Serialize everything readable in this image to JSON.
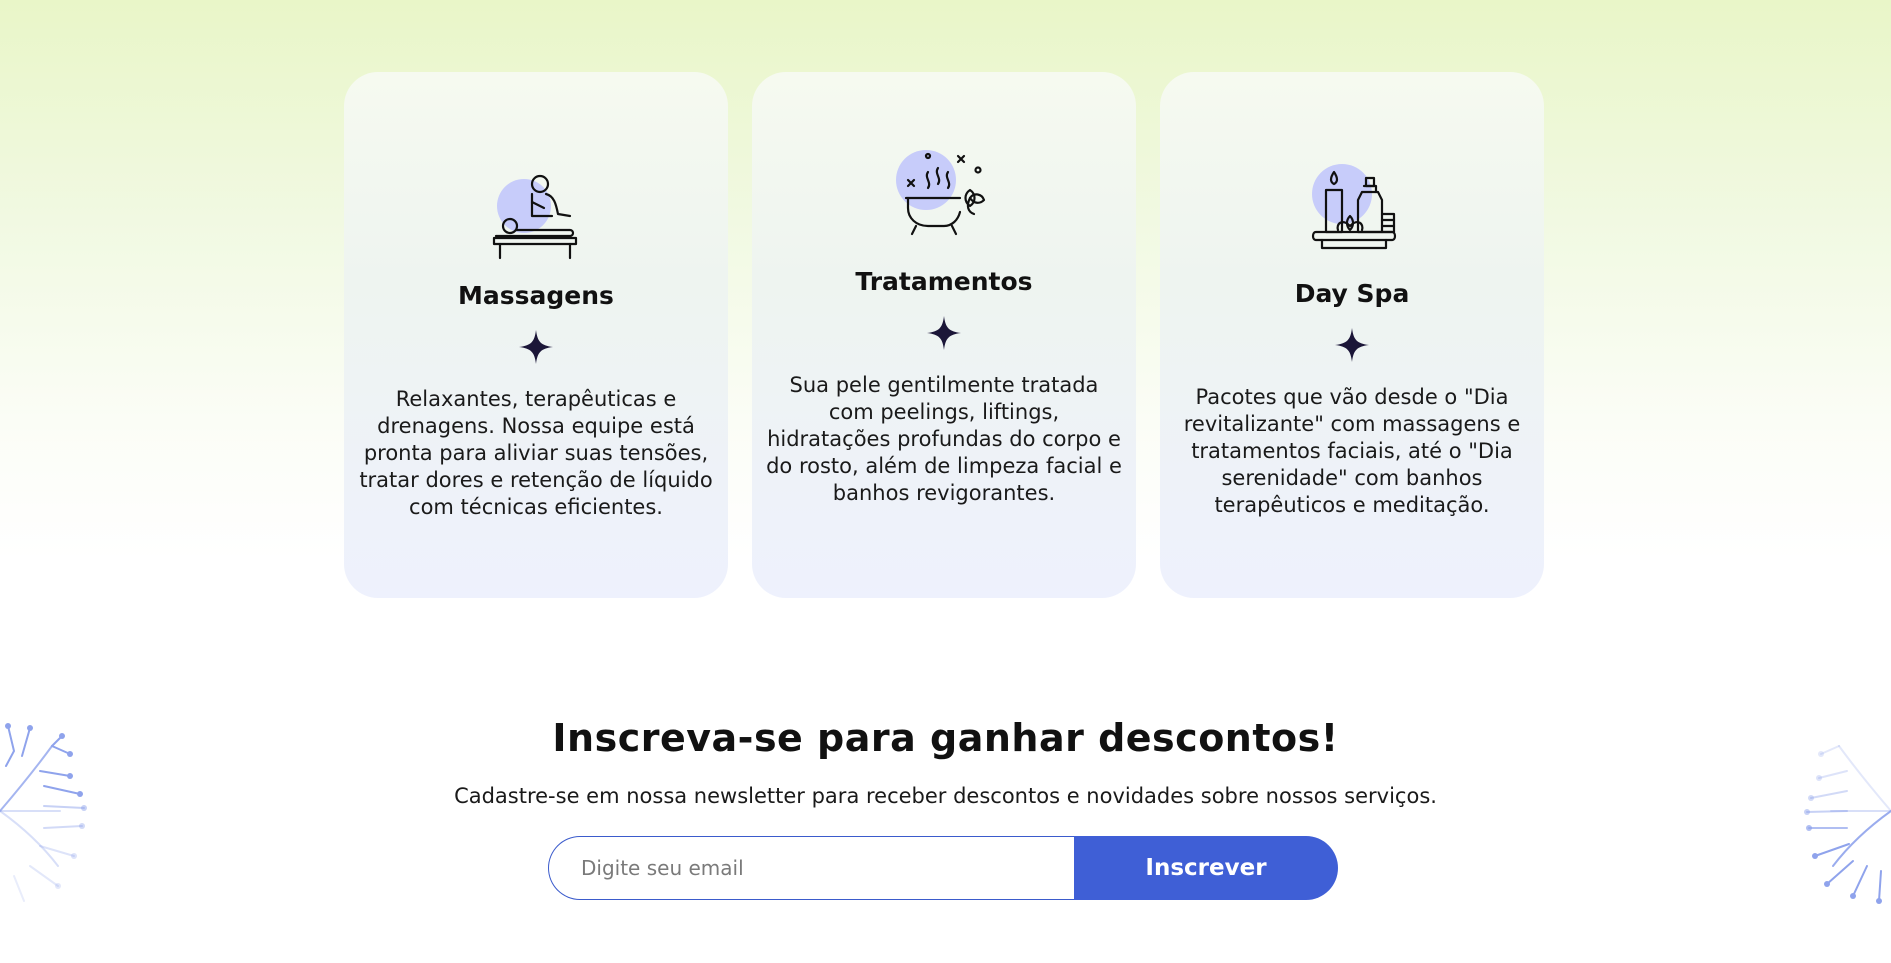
{
  "services": [
    {
      "title": "Massagens",
      "text": "Relaxantes, terapêuticas e drenagens. Nossa equipe está pronta para aliviar suas tensões, tratar dores e retenção de líquido com técnicas eficientes.",
      "icon": "massage-icon"
    },
    {
      "title": "Tratamentos",
      "text": "Sua pele gentilmente tratada com peelings, liftings, hidratações profundas do corpo e do rosto, além de limpeza facial e banhos revigorantes.",
      "icon": "bathtub-icon"
    },
    {
      "title": "Day Spa",
      "text": "Pacotes que vão desde o \"Dia revitalizante\" com massagens e tratamentos faciais, até o \"Dia serenidade\" com banhos terapêuticos e meditação.",
      "icon": "candle-spa-icon"
    }
  ],
  "newsletter": {
    "title": "Inscreva-se para ganhar descontos!",
    "subtitle": "Cadastre-se em nossa newsletter para receber descontos e novidades sobre nossos serviços.",
    "email_placeholder": "Digite seu email",
    "button_label": "Inscrever"
  },
  "colors": {
    "accent": "#3f5fd6",
    "icon_blob": "#c7ccfa",
    "background_top": "#e9f6c8",
    "card_bottom": "#eef1fd",
    "sparkle": "#1b1638"
  },
  "decorations": [
    "dandelion-left-icon",
    "dandelion-right-icon"
  ]
}
